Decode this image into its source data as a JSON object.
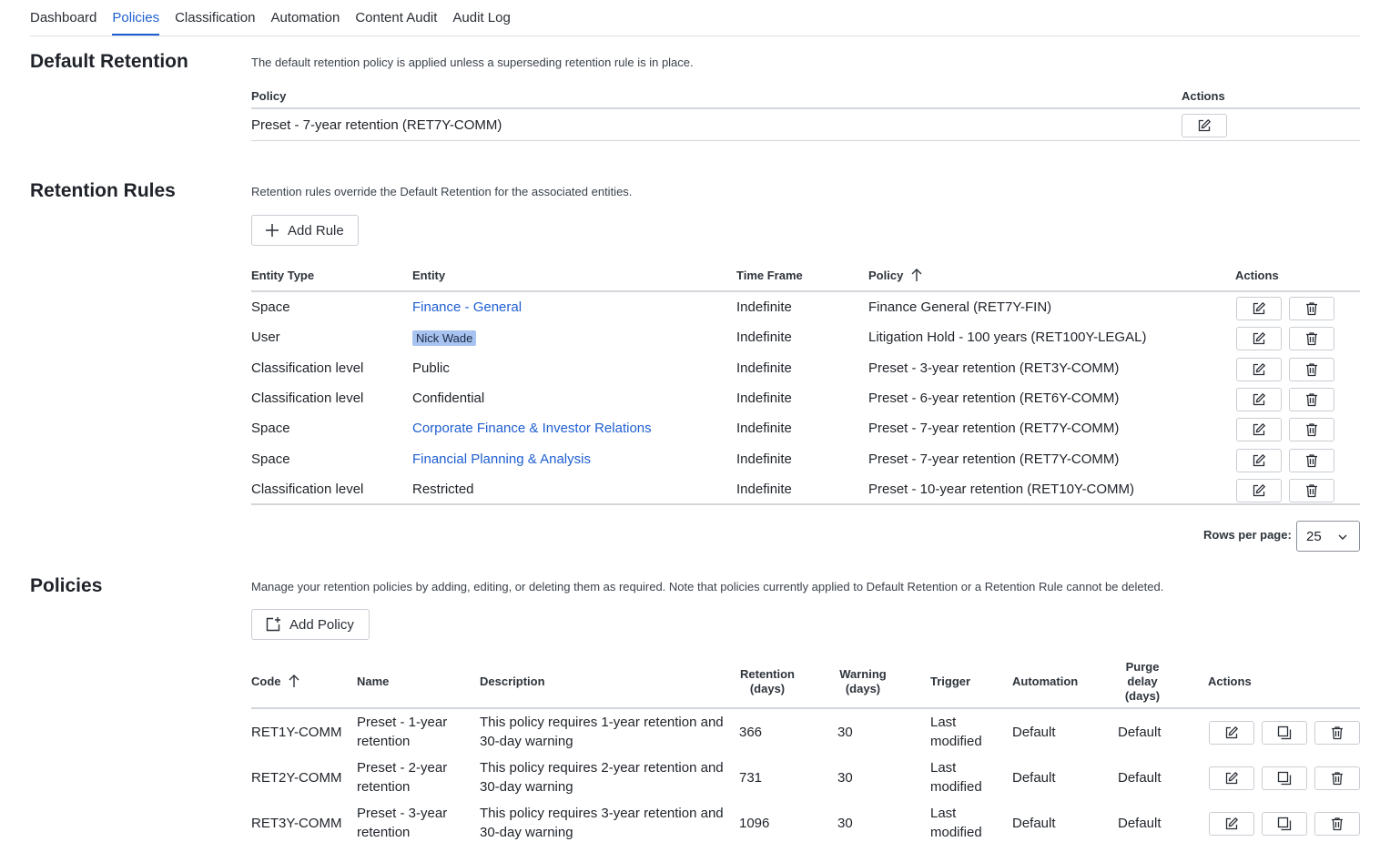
{
  "tabs": [
    {
      "label": "Dashboard",
      "active": false
    },
    {
      "label": "Policies",
      "active": true
    },
    {
      "label": "Classification",
      "active": false
    },
    {
      "label": "Automation",
      "active": false
    },
    {
      "label": "Content Audit",
      "active": false
    },
    {
      "label": "Audit Log",
      "active": false
    }
  ],
  "default_retention": {
    "title": "Default Retention",
    "description": "The default retention policy is applied unless a superseding retention rule is in place.",
    "col_policy": "Policy",
    "col_actions": "Actions",
    "policy_value": "Preset - 7-year retention (RET7Y-COMM)"
  },
  "retention_rules": {
    "title": "Retention Rules",
    "description": "Retention rules override the Default Retention for the associated entities.",
    "add_rule_label": "Add Rule",
    "columns": [
      "Entity Type",
      "Entity",
      "Time Frame",
      "Policy",
      "Actions"
    ],
    "rows": [
      {
        "entity_type": "Space",
        "entity": "Finance - General",
        "time_frame": "Indefinite",
        "policy": "Finance General (RET7Y-FIN)"
      },
      {
        "entity_type": "User",
        "entity": "Nick Wade",
        "time_frame": "Indefinite",
        "policy": "Litigation Hold - 100 years (RET100Y-LEGAL)"
      },
      {
        "entity_type": "Classification level",
        "entity": "Public",
        "time_frame": "Indefinite",
        "policy": "Preset - 3-year retention (RET3Y-COMM)"
      },
      {
        "entity_type": "Classification level",
        "entity": "Confidential",
        "time_frame": "Indefinite",
        "policy": "Preset - 6-year retention (RET6Y-COMM)"
      },
      {
        "entity_type": "Space",
        "entity": "Corporate Finance & Investor Relations",
        "time_frame": "Indefinite",
        "policy": "Preset - 7-year retention (RET7Y-COMM)"
      },
      {
        "entity_type": "Space",
        "entity": "Financial Planning & Analysis",
        "time_frame": "Indefinite",
        "policy": "Preset - 7-year retention (RET7Y-COMM)"
      },
      {
        "entity_type": "Classification level",
        "entity": "Restricted",
        "time_frame": "Indefinite",
        "policy": "Preset - 10-year retention (RET10Y-COMM)"
      }
    ],
    "rows_per_page_label": "Rows per page:",
    "rows_per_page_value": "25"
  },
  "policies": {
    "title": "Policies",
    "description": "Manage your retention policies by adding, editing, or deleting them as required. Note that policies currently applied to Default Retention or a Retention Rule cannot be deleted.",
    "add_policy_label": "Add Policy",
    "columns": {
      "code": "Code",
      "name": "Name",
      "description": "Description",
      "retention_1": "Retention",
      "retention_2": "(days)",
      "warning_1": "Warning",
      "warning_2": "(days)",
      "trigger": "Trigger",
      "automation": "Automation",
      "purge_1": "Purge",
      "purge_2": "delay",
      "purge_3": "(days)",
      "actions": "Actions"
    },
    "rows": [
      {
        "code": "RET1Y-COMM",
        "name": "Preset - 1-year retention",
        "description": "This policy requires 1-year retention and 30-day warning",
        "retention": "366",
        "warning": "30",
        "trigger": "Last modified",
        "automation": "Default",
        "purge": "Default"
      },
      {
        "code": "RET2Y-COMM",
        "name": "Preset - 2-year retention",
        "description": "This policy requires 2-year retention and 30-day warning",
        "retention": "731",
        "warning": "30",
        "trigger": "Last modified",
        "automation": "Default",
        "purge": "Default"
      },
      {
        "code": "RET3Y-COMM",
        "name": "Preset - 3-year retention",
        "description": "This policy requires 3-year retention and 30-day warning",
        "retention": "1096",
        "warning": "30",
        "trigger": "Last modified",
        "automation": "Default",
        "purge": "Default"
      }
    ]
  }
}
